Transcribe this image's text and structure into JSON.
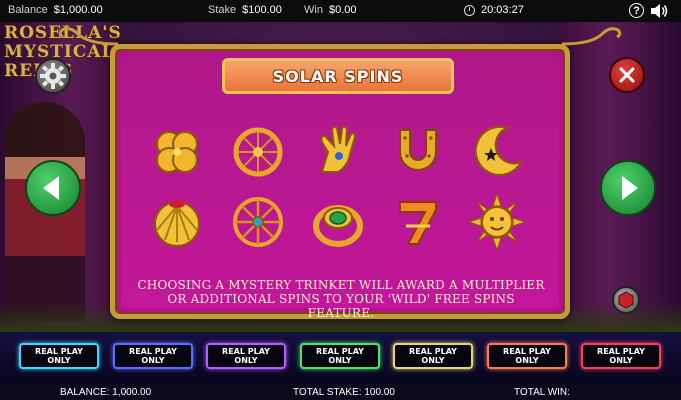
{
  "topbar": {
    "balance_label": "Balance",
    "balance_value": "$1,000.00",
    "stake_label": "Stake",
    "stake_value": "$100.00",
    "win_label": "Win",
    "win_value": "$0.00",
    "time": "20:03:27",
    "help_glyph": "?",
    "icons": [
      "clock-icon",
      "help-icon",
      "sound-icon"
    ]
  },
  "game": {
    "logo_line1": "ROSELLA'S",
    "logo_line2": "MYSTICAL",
    "logo_line3": "REELS"
  },
  "panel": {
    "title": "SOLAR SPINS",
    "description": "CHOOSING A MYSTERY TRINKET WILL AWARD A MULTIPLIER OR ADDITIONAL SPINS TO YOUR 'WILD' FREE SPINS FEATURE.",
    "trinkets": [
      "four-leaf-clover-icon",
      "dreamcatcher-icon",
      "palm-hand-icon",
      "horseshoe-icon",
      "crescent-moon-icon",
      "seashell-icon",
      "wheel-icon",
      "emerald-ring-icon",
      "number-seven-icon",
      "sun-face-icon"
    ]
  },
  "buttons": {
    "settings": "gear-icon",
    "close": "close-icon",
    "prev": "arrow-left-icon",
    "next": "arrow-right-icon",
    "gem": "gem-icon"
  },
  "real_play": {
    "label_line1": "REAL PLAY",
    "label_line2": "ONLY",
    "colors": [
      "#3fd7ff",
      "#5d6bff",
      "#b65cff",
      "#4de36a",
      "#e7d66a",
      "#ff7a4a",
      "#ff3b5c"
    ]
  },
  "footer": {
    "balance_label": "BALANCE:",
    "balance_value": "1,000.00",
    "stake_label": "TOTAL STAKE:",
    "stake_value": "100.00",
    "win_label": "TOTAL WIN:",
    "win_value": ""
  },
  "colors": {
    "panel_magenta": "#b7108a",
    "frame_gold": "#c99a3a",
    "banner_orange": "#ee8a4c",
    "go_green": "#2bb04a",
    "close_red": "#c42625"
  }
}
